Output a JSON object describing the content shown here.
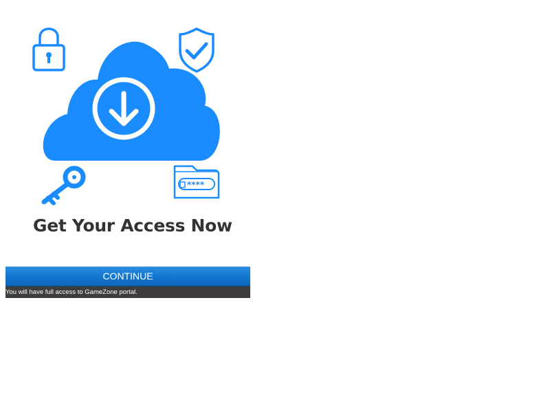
{
  "hero": {
    "icons": [
      "lock-icon",
      "shield-check-icon",
      "cloud-download-icon",
      "key-icon",
      "password-folder-icon"
    ],
    "accent_color": "#1a8cff",
    "password_mask": "****"
  },
  "headline": "Get Your Access Now",
  "cta": {
    "button_label": "CONTINUE",
    "button_color": "#1377d0",
    "note": "You will have full access to GameZone portal.",
    "note_bg": "#3d3d3d"
  }
}
